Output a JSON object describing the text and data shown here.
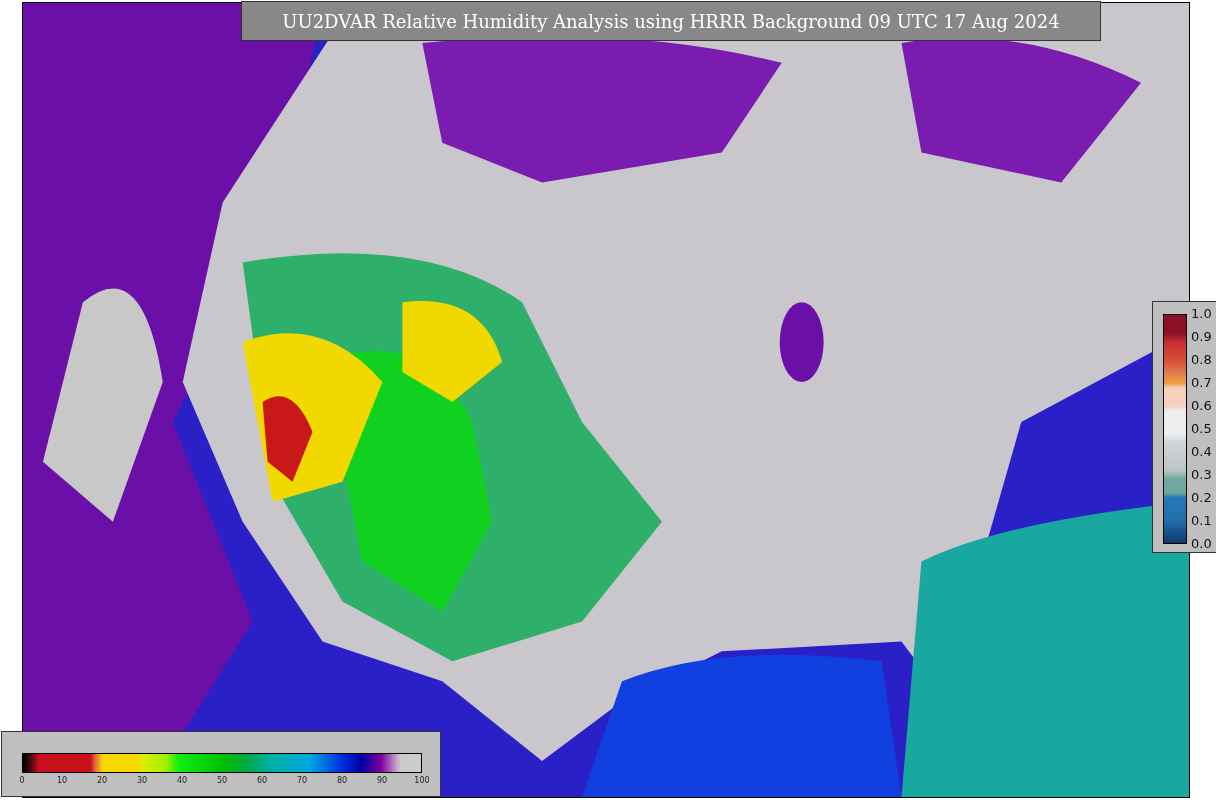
{
  "title": "UU2DVAR Relative Humidity Analysis using HRRR Background 09 UTC 17 Aug 2024",
  "humidity_colorbar": {
    "ticks": [
      "0",
      "10",
      "20",
      "30",
      "40",
      "50",
      "60",
      "70",
      "80",
      "90",
      "100"
    ]
  },
  "observation_colorbar": {
    "ticks": [
      "1.0",
      "0.9",
      "0.8",
      "0.7",
      "0.6",
      "0.5",
      "0.4",
      "0.3",
      "0.2",
      "0.1",
      "0.0"
    ]
  }
}
